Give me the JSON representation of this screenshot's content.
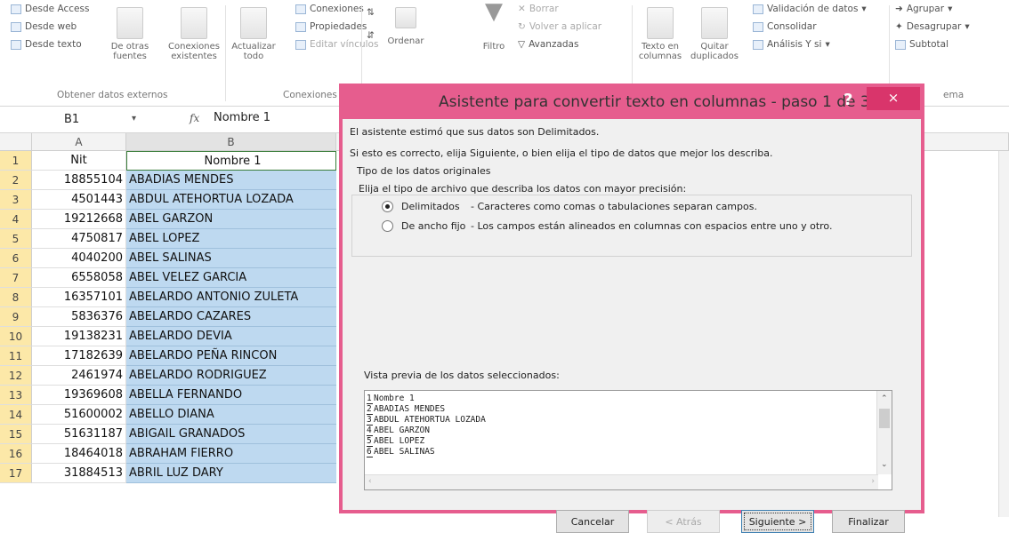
{
  "ribbon": {
    "get_external": {
      "from_access": "Desde Access",
      "from_web": "Desde web",
      "from_text": "Desde texto",
      "other_sources_1": "De otras",
      "other_sources_2": "fuentes",
      "existing_1": "Conexiones",
      "existing_2": "existentes",
      "group_label": "Obtener datos externos"
    },
    "connections": {
      "refresh_1": "Actualizar",
      "refresh_2": "todo",
      "connections": "Conexiones",
      "properties": "Propiedades",
      "edit_links": "Editar vínculos",
      "group_label": "Conexiones"
    },
    "sort": {
      "sort_label": "Ordenar",
      "filter_label": "Filtro",
      "clear": "Borrar",
      "reapply": "Volver a aplicar",
      "advanced": "Avanzadas"
    },
    "data_tools": {
      "text_to_columns_1": "Texto en",
      "text_to_columns_2": "columnas",
      "remove_dupes_1": "Quitar",
      "remove_dupes_2": "duplicados",
      "validation": "Validación de datos",
      "consolidate": "Consolidar",
      "what_if": "Análisis Y si"
    },
    "outline": {
      "group": "Agrupar",
      "ungroup": "Desagrupar",
      "subtotal": "Subtotal",
      "group_label": "ema"
    }
  },
  "formula_bar": {
    "name_box": "B1",
    "fx": "fx",
    "value": "Nombre 1"
  },
  "columns": [
    "A",
    "B"
  ],
  "rows": [
    {
      "n": "1",
      "a": "Nit",
      "b": "Nombre 1"
    },
    {
      "n": "2",
      "a": "18855104",
      "b": "ABADIAS MENDES"
    },
    {
      "n": "3",
      "a": "4501443",
      "b": "ABDUL ATEHORTUA LOZADA"
    },
    {
      "n": "4",
      "a": "19212668",
      "b": "ABEL GARZON"
    },
    {
      "n": "5",
      "a": "4750817",
      "b": "ABEL LOPEZ"
    },
    {
      "n": "6",
      "a": "4040200",
      "b": "ABEL SALINAS"
    },
    {
      "n": "7",
      "a": "6558058",
      "b": "ABEL VELEZ GARCIA"
    },
    {
      "n": "8",
      "a": "16357101",
      "b": "ABELARDO ANTONIO ZULETA"
    },
    {
      "n": "9",
      "a": "5836376",
      "b": "ABELARDO CAZARES"
    },
    {
      "n": "10",
      "a": "19138231",
      "b": "ABELARDO DEVIA"
    },
    {
      "n": "11",
      "a": "17182639",
      "b": "ABELARDO PEÑA RINCON"
    },
    {
      "n": "12",
      "a": "2461974",
      "b": "ABELARDO RODRIGUEZ"
    },
    {
      "n": "13",
      "a": "19369608",
      "b": "ABELLA FERNANDO"
    },
    {
      "n": "14",
      "a": "51600002",
      "b": "ABELLO DIANA"
    },
    {
      "n": "15",
      "a": "51631187",
      "b": "ABIGAIL GRANADOS"
    },
    {
      "n": "16",
      "a": "18464018",
      "b": "ABRAHAM FIERRO"
    },
    {
      "n": "17",
      "a": "31884513",
      "b": "ABRIL LUZ DARY"
    }
  ],
  "dialog": {
    "title": "Asistente para convertir texto en columnas - paso 1 de 3",
    "help": "?",
    "close": "×",
    "intro1": "El asistente estimó que sus datos son Delimitados.",
    "intro2": "Si esto es correcto, elija Siguiente, o bien elija el tipo de datos que mejor los describa.",
    "group_title": "Tipo de los datos originales",
    "group_prompt": "Elija el tipo de archivo que describa los datos con mayor precisión:",
    "opt_delimited": "Delimitados",
    "opt_delimited_desc": "- Caracteres como comas o tabulaciones separan campos.",
    "opt_fixed": "De ancho fijo",
    "opt_fixed_desc": "- Los campos están alineados en columnas con espacios entre uno y otro.",
    "preview_label": "Vista previa de los datos seleccionados:",
    "preview_lines": [
      "Nombre 1",
      "ABADIAS MENDES",
      "ABDUL ATEHORTUA LOZADA",
      "ABEL GARZON",
      "ABEL LOPEZ",
      "ABEL SALINAS"
    ],
    "btn_cancel": "Cancelar",
    "btn_back": "< Atrás",
    "btn_next": "Siguiente >",
    "btn_finish": "Finalizar"
  }
}
